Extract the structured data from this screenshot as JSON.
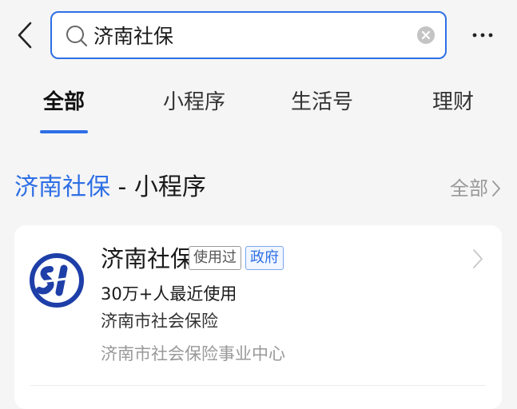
{
  "search": {
    "query": "济南社保",
    "placeholder": ""
  },
  "icons": {
    "back": "chevron-left-icon",
    "search": "magnifier-icon",
    "clear": "clear-circle-icon",
    "more": "more-dots-icon",
    "section_more": "chevron-right-icon",
    "card_arrow": "chevron-right-icon"
  },
  "tabs": [
    {
      "label": "全部",
      "active": true
    },
    {
      "label": "小程序",
      "active": false
    },
    {
      "label": "生活号",
      "active": false
    },
    {
      "label": "理财",
      "active": false
    }
  ],
  "section": {
    "title_highlight": "济南社保",
    "title_rest": " - 小程序",
    "all_label": "全部"
  },
  "result": {
    "name": "济南社保",
    "badges": [
      "使用过",
      "政府"
    ],
    "usage": "30万+人最近使用",
    "description": "济南市社会保险",
    "organization": "济南市社会保险事业中心"
  },
  "colors": {
    "accent": "#2e6fe6",
    "background": "#f5f5f5",
    "card": "#ffffff",
    "muted_text": "#999999",
    "logo_blue": "#1e3fa8"
  }
}
